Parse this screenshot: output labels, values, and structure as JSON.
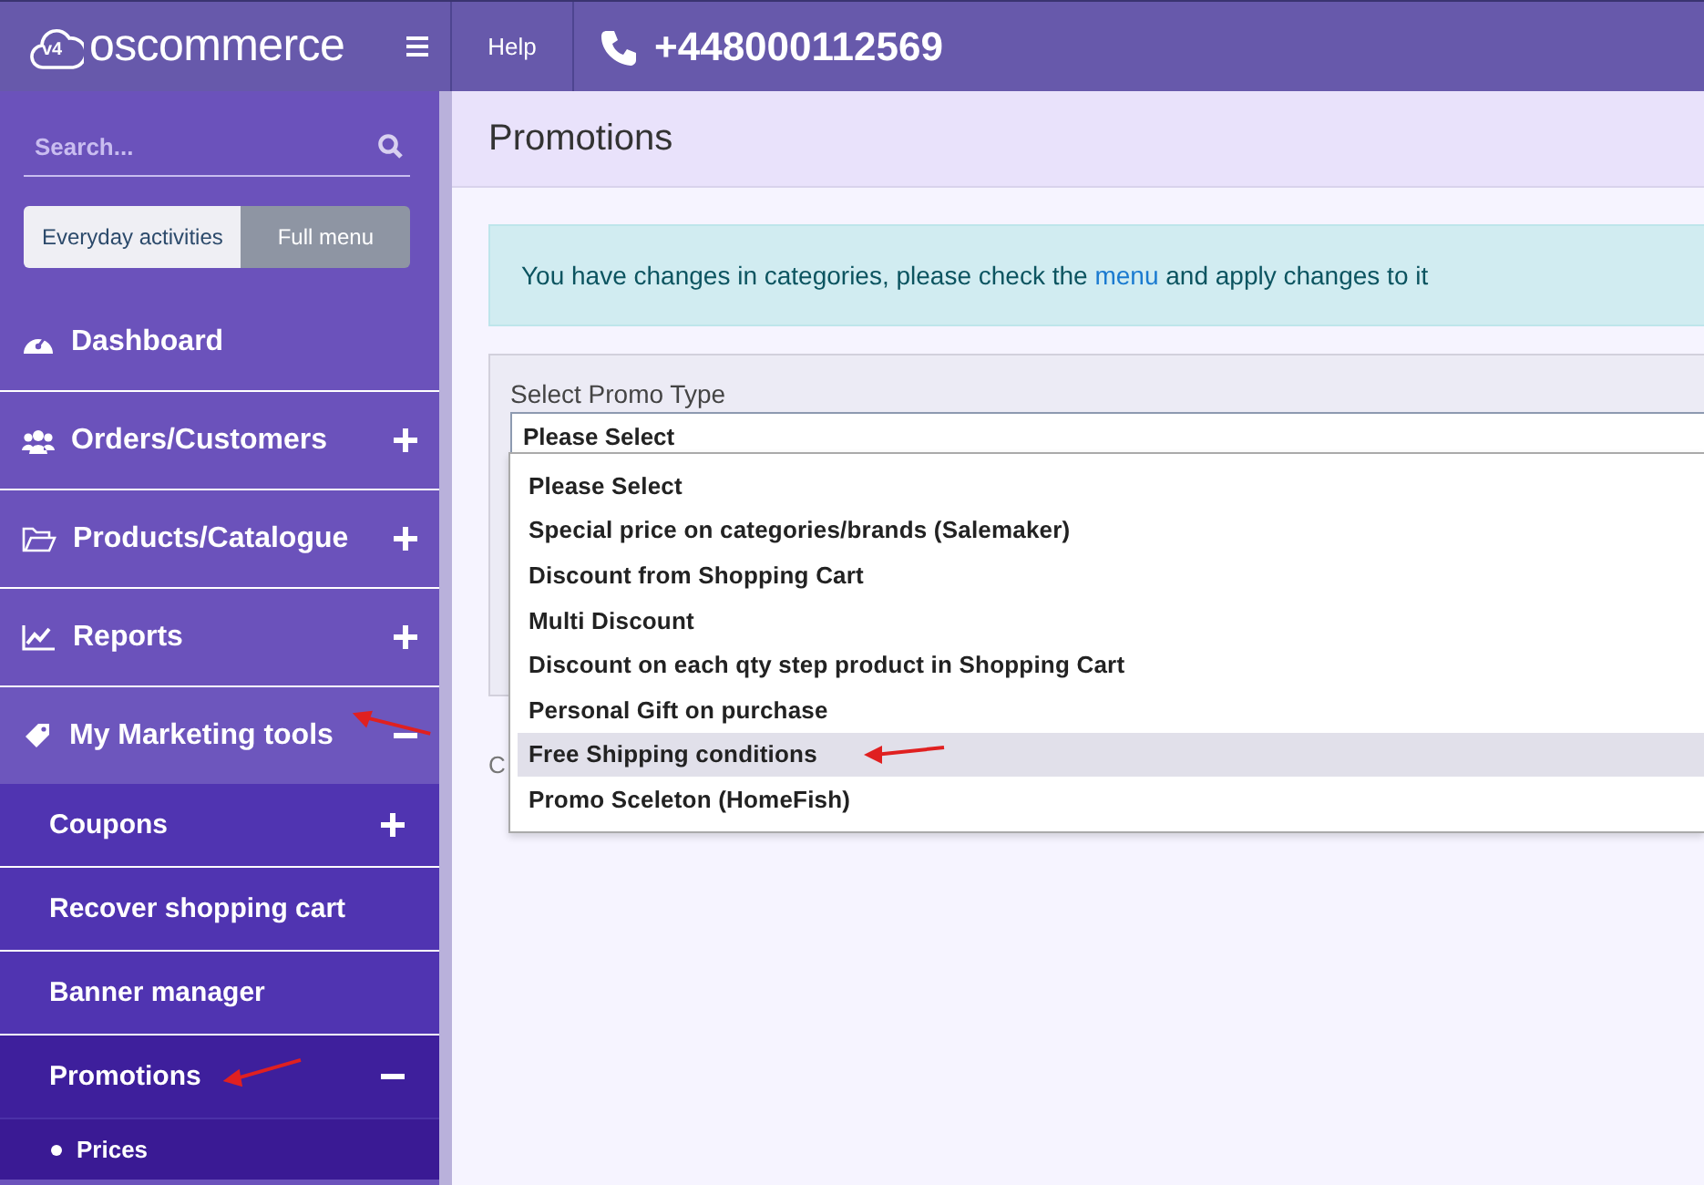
{
  "topbar": {
    "logo": "oscommerce",
    "logo_badge": "v4",
    "help": "Help",
    "phone": "+448000112569"
  },
  "sidebar": {
    "search": {
      "placeholder": "Search..."
    },
    "modes": [
      {
        "label": "Everyday activities",
        "selected": false
      },
      {
        "label": "Full menu",
        "selected": true
      }
    ],
    "items": [
      {
        "label": "Dashboard",
        "expandable": false,
        "expanded": false
      },
      {
        "label": "Orders/Customers",
        "expandable": true,
        "expanded": false
      },
      {
        "label": "Products/Catalogue",
        "expandable": true,
        "expanded": false
      },
      {
        "label": "Reports",
        "expandable": true,
        "expanded": false
      },
      {
        "label": "My Marketing tools",
        "expandable": true,
        "expanded": true,
        "marked": true,
        "children": [
          {
            "label": "Coupons",
            "expandable": true,
            "expanded": false
          },
          {
            "label": "Recover shopping cart",
            "expandable": false,
            "expanded": false
          },
          {
            "label": "Banner manager",
            "expandable": false,
            "expanded": false
          },
          {
            "label": "Promotions",
            "expandable": true,
            "expanded": true,
            "selected": true,
            "marked": true,
            "children": [
              {
                "label": "Prices"
              }
            ]
          }
        ]
      }
    ]
  },
  "page": {
    "title": "Promotions",
    "alert": {
      "text_before": "You have changes in categories, please check the",
      "link": "menu",
      "text_after": "and apply changes to it"
    },
    "promo_form": {
      "label": "Select Promo Type",
      "value": "Please Select",
      "hidden_text": "C",
      "options": [
        {
          "label": "Please Select",
          "highlighted": false
        },
        {
          "label": "Special price on categories/brands (Salemaker)",
          "highlighted": false
        },
        {
          "label": "Discount from Shopping Cart",
          "highlighted": false
        },
        {
          "label": "Multi Discount",
          "highlighted": false
        },
        {
          "label": "Discount on each qty step product in Shopping Cart",
          "highlighted": false
        },
        {
          "label": "Personal Gift on purchase",
          "highlighted": false
        },
        {
          "label": "Free Shipping conditions",
          "highlighted": true,
          "marked": true
        },
        {
          "label": "Promo Sceleton (HomeFish)",
          "highlighted": false
        }
      ]
    }
  }
}
